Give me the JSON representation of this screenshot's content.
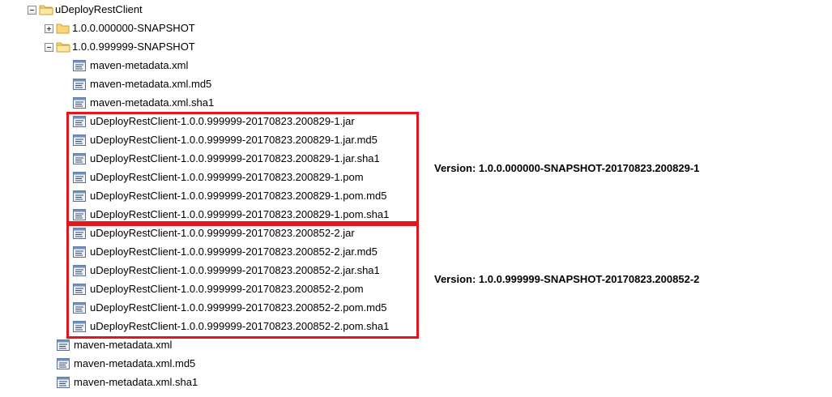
{
  "tree": {
    "root": {
      "label": "uDeployRestClient",
      "expanded": true
    },
    "folder_1": {
      "label": "1.0.0.000000-SNAPSHOT",
      "expanded": false
    },
    "folder_2": {
      "label": "1.0.0.999999-SNAPSHOT",
      "expanded": true
    },
    "folder_2_files": [
      "maven-metadata.xml",
      "maven-metadata.xml.md5",
      "maven-metadata.xml.sha1",
      "uDeployRestClient-1.0.0.999999-20170823.200829-1.jar",
      "uDeployRestClient-1.0.0.999999-20170823.200829-1.jar.md5",
      "uDeployRestClient-1.0.0.999999-20170823.200829-1.jar.sha1",
      "uDeployRestClient-1.0.0.999999-20170823.200829-1.pom",
      "uDeployRestClient-1.0.0.999999-20170823.200829-1.pom.md5",
      "uDeployRestClient-1.0.0.999999-20170823.200829-1.pom.sha1",
      "uDeployRestClient-1.0.0.999999-20170823.200852-2.jar",
      "uDeployRestClient-1.0.0.999999-20170823.200852-2.jar.md5",
      "uDeployRestClient-1.0.0.999999-20170823.200852-2.jar.sha1",
      "uDeployRestClient-1.0.0.999999-20170823.200852-2.pom",
      "uDeployRestClient-1.0.0.999999-20170823.200852-2.pom.md5",
      "uDeployRestClient-1.0.0.999999-20170823.200852-2.pom.sha1"
    ],
    "root_files": [
      "maven-metadata.xml",
      "maven-metadata.xml.md5",
      "maven-metadata.xml.sha1"
    ]
  },
  "annotations": {
    "group_1": "Version: 1.0.0.000000-SNAPSHOT-20170823.200829-1",
    "group_2": "Version: 1.0.0.999999-SNAPSHOT-20170823.200852-2"
  },
  "colors": {
    "highlight_border": "#e2161c",
    "folder_fill": "#f5d77a",
    "folder_stroke": "#c8a23a"
  },
  "icons": {
    "expanded_toggle": "minus-toggle-icon",
    "collapsed_toggle": "plus-toggle-icon",
    "folder": "folder-icon",
    "open_folder": "folder-open-icon",
    "file": "file-icon"
  }
}
